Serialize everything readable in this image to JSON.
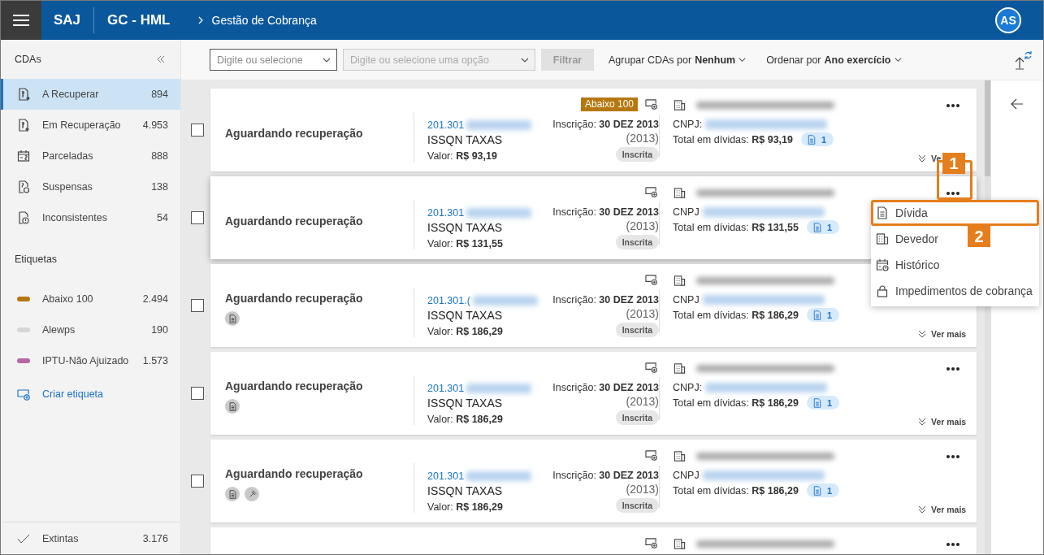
{
  "header": {
    "app": "SAJ",
    "environment": "GC - HML",
    "breadcrumb": "Gestão de Cobrança",
    "avatar": "AS"
  },
  "sidebar": {
    "title": "CDAs",
    "items": [
      {
        "label": "A Recuperar",
        "count": "894",
        "kind": "doc-out",
        "selected": true
      },
      {
        "label": "Em Recuperação",
        "count": "4.953",
        "kind": "doc-in",
        "selected": false
      },
      {
        "label": "Parceladas",
        "count": "888",
        "kind": "calendar",
        "selected": false
      },
      {
        "label": "Suspensas",
        "count": "138",
        "kind": "doc-clock",
        "selected": false
      },
      {
        "label": "Inconsistentes",
        "count": "54",
        "kind": "doc-alert",
        "selected": false
      }
    ],
    "tags_title": "Etiquetas",
    "tags": [
      {
        "label": "Abaixo 100",
        "count": "2.494",
        "color": "#b5770f"
      },
      {
        "label": "Alewps",
        "count": "190",
        "color": "#d6d6d6"
      },
      {
        "label": "IPTU-Não Ajuizado",
        "count": "1.573",
        "color": "#b866a8"
      }
    ],
    "create_tag": "Criar etiqueta",
    "footer": {
      "label": "Extintas",
      "count": "3.176"
    }
  },
  "toolbar": {
    "select_1": {
      "placeholder": "Digite ou selecione",
      "disabled": false
    },
    "select_2": {
      "placeholder": "Digite ou selecione uma opção",
      "disabled": true
    },
    "filter_button": {
      "label": "Filtrar",
      "disabled": true
    },
    "group_by": {
      "label": "Agrupar CDAs por",
      "value": "Nenhum"
    },
    "order_by": {
      "label": "Ordenar por",
      "value": "Ano exercício"
    }
  },
  "cards": [
    {
      "kind": "full",
      "checked": false,
      "hovered": false,
      "status": "Aguardando recuperação",
      "number": "201.301",
      "tax": "ISSQN TAXAS",
      "value_label": "Valor:",
      "value": "R$ 93,19",
      "tag": {
        "label": "Abaixo 100",
        "color": "#b5770f"
      },
      "registration_label": "Inscrição:",
      "registration": "30 DEZ 2013",
      "year": "(2013)",
      "situation": "Inscrita",
      "cnpj_label": "CNPJ:",
      "total_label": "Total em dívidas:",
      "total": "R$ 93,19",
      "doc_count": "1",
      "more": "Ve"
    },
    {
      "kind": "full",
      "checked": false,
      "hovered": true,
      "status": "Aguardando recuperação",
      "number": "201.301",
      "tax": "ISSQN TAXAS",
      "value_label": "Valor:",
      "value": "R$ 131,55",
      "registration_label": "Inscrição:",
      "registration": "30 DEZ 2013",
      "year": "(2013)",
      "situation": "Inscrita",
      "cnpj_label": "CNPJ",
      "total_label": "Total em dívidas:",
      "total": "R$ 131,55",
      "doc_count": "1",
      "marker": "1"
    },
    {
      "kind": "full",
      "checked": false,
      "hovered": false,
      "status": "Aguardando recuperação",
      "status_icons": [
        {
          "kind": "document"
        }
      ],
      "number": "201.301.(",
      "tax": "ISSQN TAXAS",
      "value_label": "Valor:",
      "value": "R$ 186,29",
      "registration_label": "Inscrição:",
      "registration": "30 DEZ 2013",
      "year": "(2013)",
      "situation": "Inscrita",
      "cnpj_label": "CNPJ",
      "total_label": "Total em dívidas:",
      "total": "R$ 186,29",
      "doc_count": "1",
      "more": "Ver mais"
    },
    {
      "kind": "full",
      "checked": false,
      "hovered": false,
      "status": "Aguardando recuperação",
      "status_icons": [
        {
          "kind": "document"
        }
      ],
      "number": "201.301",
      "tax": "ISSQN TAXAS",
      "value_label": "Valor:",
      "value": "R$ 186,29",
      "registration_label": "Inscrição:",
      "registration": "30 DEZ 2013",
      "year": "(2013)",
      "situation": "Inscrita",
      "cnpj_label": "CNPJ:",
      "total_label": "Total em dívidas:",
      "total": "R$ 186,29",
      "doc_count": "1",
      "more": "Ver mais"
    },
    {
      "kind": "full",
      "checked": false,
      "hovered": false,
      "status": "Aguardando recuperação",
      "status_icons": [
        {
          "kind": "document"
        },
        {
          "kind": "gavel"
        }
      ],
      "number": "201.301",
      "tax": "ISSQN TAXAS",
      "value_label": "Valor:",
      "value": "R$ 186,29",
      "registration_label": "Inscrição:",
      "registration": "30 DEZ 2013",
      "year": "(2013)",
      "situation": "Inscrita",
      "cnpj_label": "CNPJ",
      "total_label": "Total em dívidas:",
      "total": "R$ 186,29",
      "doc_count": "1",
      "more": "Ver mais"
    },
    {
      "kind": "partial"
    }
  ],
  "menu": {
    "items": [
      {
        "label": "Dívida",
        "kind": "document",
        "marker": "2"
      },
      {
        "label": "Devedor",
        "kind": "building"
      },
      {
        "label": "Histórico",
        "kind": "calendar-clock"
      },
      {
        "label": "Impedimentos de cobrança",
        "kind": "lock"
      }
    ]
  }
}
